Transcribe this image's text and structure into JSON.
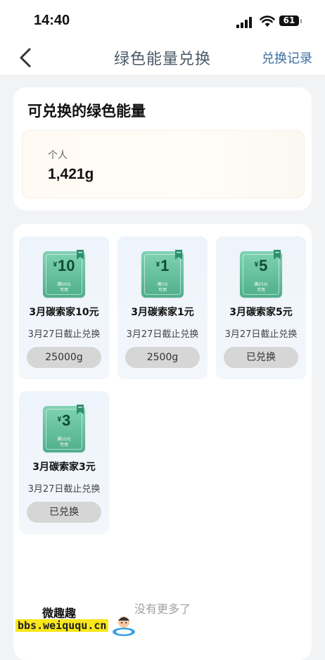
{
  "status_bar": {
    "time": "14:40",
    "battery": "61"
  },
  "nav": {
    "title": "绿色能量兑换",
    "right_link": "兑换记录"
  },
  "energy": {
    "title": "可兑换的绿色能量",
    "label": "个人",
    "value": "1,421g"
  },
  "cards": [
    {
      "amount": "10",
      "sub1": "满50元",
      "sub2": "可用",
      "title": "3月碳索家10元",
      "deadline": "3月27日截止兑换",
      "button": "25000g"
    },
    {
      "amount": "1",
      "sub1": "满5元",
      "sub2": "可用",
      "title": "3月碳索家1元",
      "deadline": "3月27日截止兑换",
      "button": "2500g"
    },
    {
      "amount": "5",
      "sub1": "满25元",
      "sub2": "可用",
      "title": "3月碳索家5元",
      "deadline": "3月27日截止兑换",
      "button": "已兑换"
    },
    {
      "amount": "3",
      "sub1": "满15元",
      "sub2": "可用",
      "title": "3月碳索家3元",
      "deadline": "3月27日截止兑换",
      "button": "已兑换"
    }
  ],
  "currency_symbol": "¥",
  "footer": {
    "no_more": "没有更多了"
  },
  "watermark": {
    "top": "微趣趣",
    "bottom": "bbs.weiququ.cn"
  },
  "colors": {
    "accent_link": "#3d6fa0",
    "ticket_green": "#4fae8b",
    "button_gray": "#d6d6d6"
  }
}
